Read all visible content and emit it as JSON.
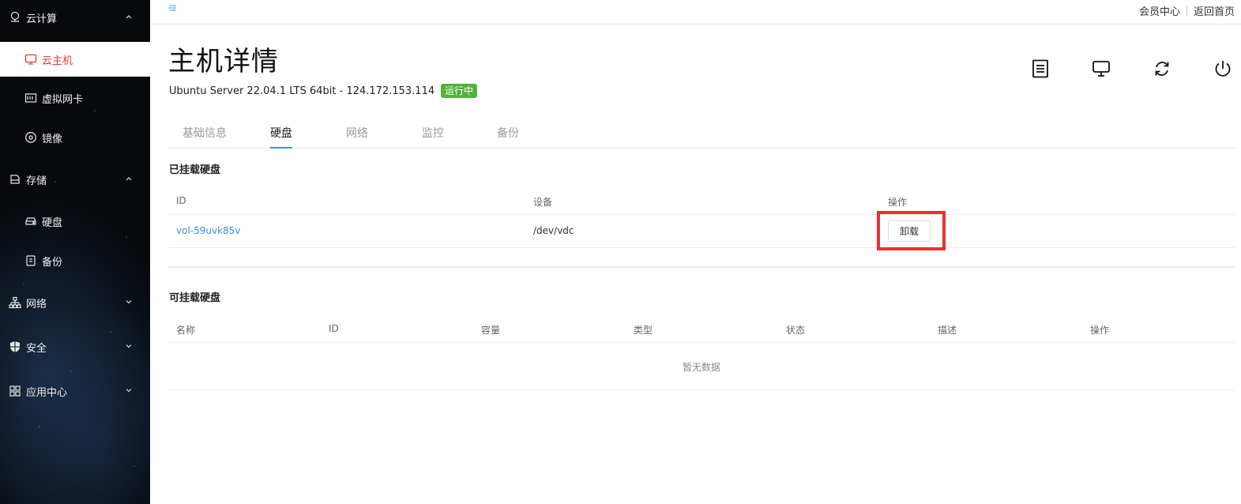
{
  "sidebar": {
    "groups": [
      {
        "label": "云计算",
        "icon": "cloud-icon",
        "expanded": true
      },
      {
        "label": "存储",
        "icon": "storage-icon",
        "expanded": true
      },
      {
        "label": "网络",
        "icon": "network-icon",
        "expanded": false
      },
      {
        "label": "安全",
        "icon": "shield-icon",
        "expanded": false
      },
      {
        "label": "应用中心",
        "icon": "apps-icon",
        "expanded": false
      }
    ],
    "items": [
      {
        "label": "云主机",
        "icon": "monitor-icon",
        "active": true
      },
      {
        "label": "虚拟网卡",
        "icon": "nic-icon"
      },
      {
        "label": "镜像",
        "icon": "disc-icon"
      },
      {
        "label": "硬盘",
        "icon": "hdd-icon"
      },
      {
        "label": "备份",
        "icon": "backup-icon"
      }
    ]
  },
  "topbar": {
    "member_center": "会员中心",
    "back_home": "返回首页"
  },
  "header": {
    "title": "主机详情",
    "subtitle": "Ubuntu Server 22.04.1 LTS 64bit - 124.172.153.114",
    "status": "运行中",
    "actions": [
      "document-icon",
      "monitor-icon",
      "refresh-icon",
      "power-icon"
    ]
  },
  "tabs": [
    {
      "label": "基础信息"
    },
    {
      "label": "硬盘",
      "active": true
    },
    {
      "label": "网络"
    },
    {
      "label": "监控"
    },
    {
      "label": "备份"
    }
  ],
  "mounted": {
    "title": "已挂载硬盘",
    "columns": [
      "ID",
      "设备",
      "操作"
    ],
    "rows": [
      {
        "id": "vol-59uvk85v",
        "device": "/dev/vdc",
        "action": "卸载"
      }
    ]
  },
  "available": {
    "title": "可挂载硬盘",
    "columns": [
      "名称",
      "ID",
      "容量",
      "类型",
      "状态",
      "描述",
      "操作"
    ],
    "empty_text": "暂无数据"
  },
  "colors": {
    "accent": "#1e9be8",
    "active_red": "#e23a2e",
    "status_green": "#52b13a",
    "link_blue": "#3a8ee6",
    "highlight_red": "#ee2f2f"
  }
}
